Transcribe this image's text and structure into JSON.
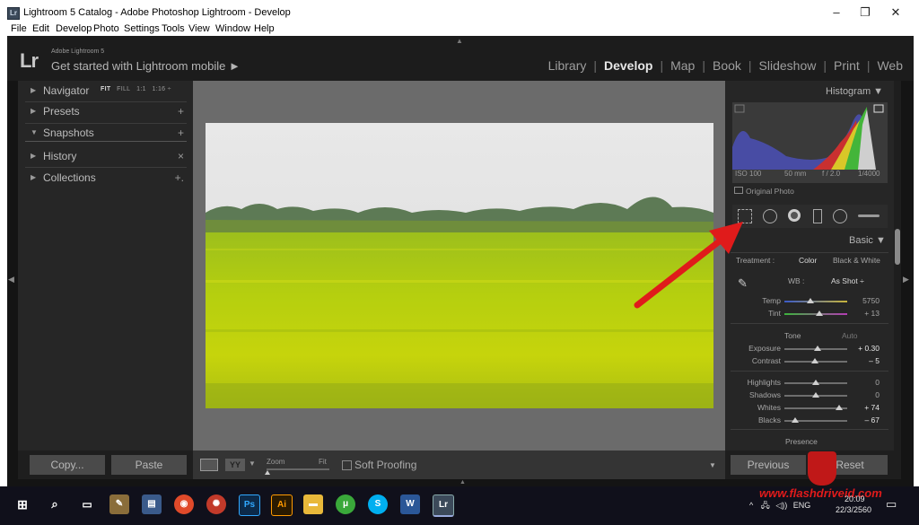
{
  "window": {
    "title": "Lightroom 5 Catalog - Adobe Photoshop Lightroom - Develop",
    "app_icon": "Lr",
    "minimize": "–",
    "restore": "❐",
    "close": "✕"
  },
  "menu": [
    "File",
    "Edit",
    "Develop",
    "Photo",
    "Settings",
    "Tools",
    "View",
    "Window",
    "Help"
  ],
  "identity": {
    "logo": "Lr",
    "product": "Adobe Lightroom 5",
    "cta": "Get started with Lightroom mobile ►"
  },
  "modules": [
    "Library",
    "Develop",
    "Map",
    "Book",
    "Slideshow",
    "Print",
    "Web"
  ],
  "active_module": "Develop",
  "left_panel": {
    "navigator": {
      "label": "Navigator",
      "options": [
        "FIT",
        "FILL",
        "1:1",
        "1:16 ÷"
      ]
    },
    "presets": {
      "label": "Presets",
      "action": "+"
    },
    "snapshots": {
      "label": "Snapshots",
      "action": "+"
    },
    "history": {
      "label": "History",
      "action": "×"
    },
    "collections": {
      "label": "Collections",
      "action": "+."
    }
  },
  "histogram": {
    "title": "Histogram ▼",
    "exif": [
      "ISO 100",
      "50 mm",
      "f / 2.0",
      "1/4000"
    ],
    "original_photo": "Original Photo"
  },
  "basic": {
    "title": "Basic ▼",
    "treatment_label": "Treatment :",
    "treatment_color": "Color",
    "treatment_bw": "Black & White",
    "wb_label": "WB :",
    "wb_value": "As Shot ÷",
    "tone_label": "Tone",
    "auto_label": "Auto",
    "presence_label": "Presence",
    "sliders": [
      {
        "name": "Temp",
        "value": "5750",
        "level": 0.42
      },
      {
        "name": "Tint",
        "value": "+ 13",
        "level": 0.55
      },
      {
        "name": "Exposure",
        "value": "+ 0.30",
        "level": 0.53
      },
      {
        "name": "Contrast",
        "value": "– 5",
        "level": 0.48
      },
      {
        "name": "Highlights",
        "value": "0",
        "level": 0.5
      },
      {
        "name": "Shadows",
        "value": "0",
        "level": 0.5
      },
      {
        "name": "Whites",
        "value": "+ 74",
        "level": 0.87
      },
      {
        "name": "Blacks",
        "value": "– 67",
        "level": 0.17
      }
    ]
  },
  "bottom": {
    "copy": "Copy...",
    "paste": "Paste",
    "zoom_label": "Zoom",
    "fit_label": "Fit",
    "soft_proofing": "Soft Proofing",
    "previous": "Previous",
    "reset": "Reset"
  },
  "watermark": "www.flashdriveid.com",
  "tray": {
    "lang": "ENG",
    "time": "20:09",
    "date": "22/3/2560"
  },
  "colors": {
    "accent": "#e01b1b",
    "panel": "#262626",
    "center": "#6b6b6b",
    "frame": "#141414"
  }
}
